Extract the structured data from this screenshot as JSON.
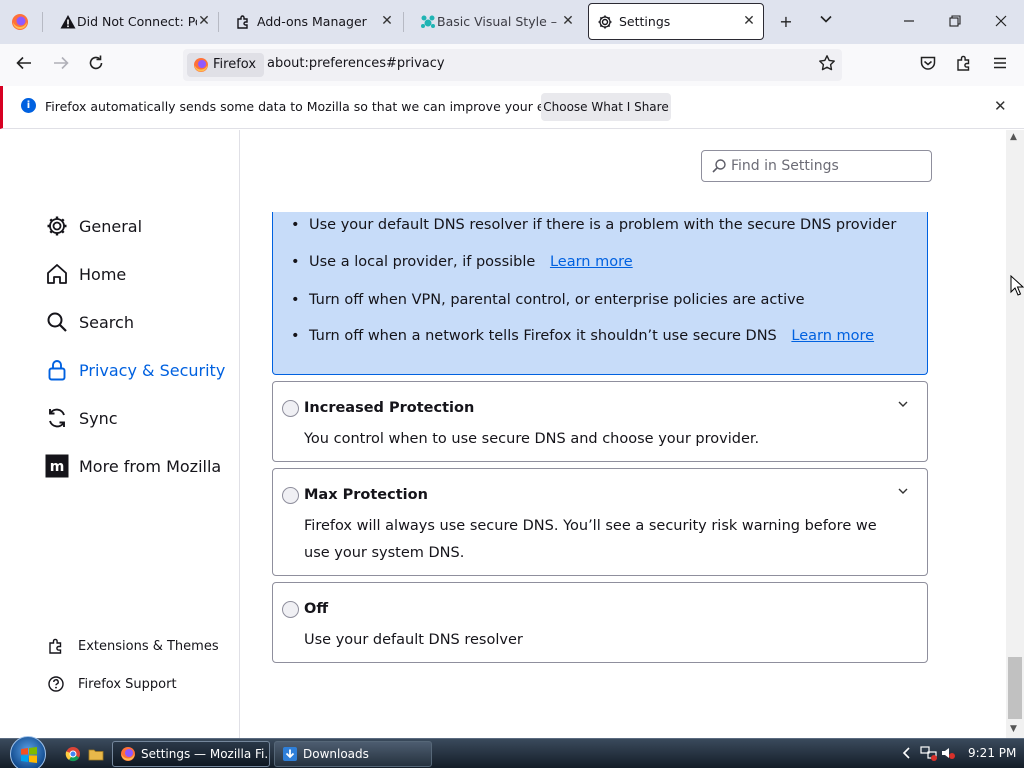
{
  "tabs": [
    {
      "title": "Did Not Connect: Pote",
      "icon": "warning-icon"
    },
    {
      "title": "Add-ons Manager",
      "icon": "puzzle-icon"
    },
    {
      "title": "Basic Visual Style – Get",
      "icon": "addon-paw-icon"
    },
    {
      "title": "Settings",
      "icon": "gear-icon",
      "active": true
    }
  ],
  "nav": {
    "identity_label": "Firefox",
    "url": "about:preferences#privacy"
  },
  "notification": {
    "text": "Firefox automatically sends some data to Mozilla so that we can improve your experience.",
    "button": "Choose What I Share"
  },
  "sidebar": {
    "categories": [
      {
        "label": "General",
        "icon": "gear-icon"
      },
      {
        "label": "Home",
        "icon": "home-icon"
      },
      {
        "label": "Search",
        "icon": "search-icon"
      },
      {
        "label": "Privacy & Security",
        "icon": "lock-icon",
        "selected": true
      },
      {
        "label": "Sync",
        "icon": "sync-icon"
      },
      {
        "label": "More from Mozilla",
        "icon": "mozilla-icon"
      }
    ],
    "footer": [
      {
        "label": "Extensions & Themes",
        "icon": "puzzle-icon"
      },
      {
        "label": "Firefox Support",
        "icon": "help-icon"
      }
    ]
  },
  "main": {
    "search_placeholder": "Find in Settings",
    "default_bullets": [
      {
        "text": "Use your default DNS resolver if there is a problem with the secure DNS provider",
        "link": ""
      },
      {
        "text": "Use a local provider, if possible",
        "link": "Learn more"
      },
      {
        "text": "Turn off when VPN, parental control, or enterprise policies are active",
        "link": ""
      },
      {
        "text": "Turn off when a network tells Firefox it shouldn’t use secure DNS",
        "link": "Learn more"
      }
    ],
    "options": [
      {
        "title": "Increased Protection",
        "desc": "You control when to use secure DNS and choose your provider.",
        "expandable": true
      },
      {
        "title": "Max Protection",
        "desc": "Firefox will always use secure DNS. You’ll see a security risk warning before we use your system DNS.",
        "expandable": true
      },
      {
        "title": "Off",
        "desc": "Use your default DNS resolver",
        "expandable": false
      }
    ]
  },
  "taskbar": {
    "buttons": [
      {
        "label": "Settings — Mozilla Fi...",
        "active": true
      },
      {
        "label": "Downloads",
        "active": false
      }
    ],
    "clock": "9:21 PM"
  },
  "colors": {
    "accent": "#0061e0",
    "selected_option_bg": "#c7dcf9"
  }
}
